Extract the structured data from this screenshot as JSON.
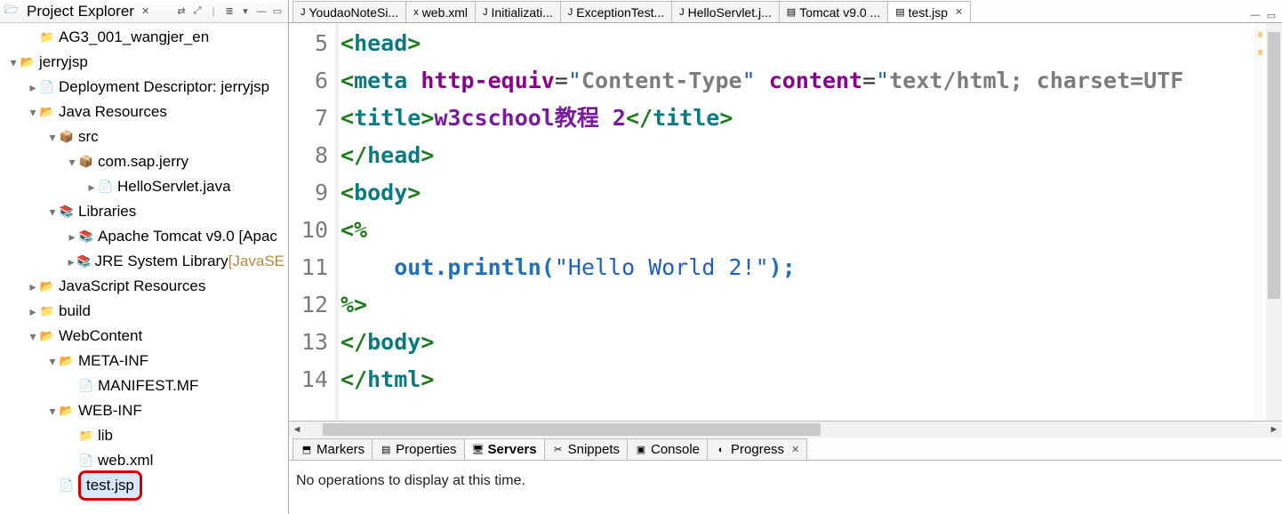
{
  "explorer": {
    "title": "Project Explorer",
    "toolbar": [
      "link-editor-icon",
      "collapse-all-icon",
      "view-menu-icon",
      "minimize-icon",
      "maximize-icon"
    ],
    "nodes": [
      {
        "indent": 1,
        "arrow": "",
        "icon": "📁",
        "label": "AG3_001_wangjer_en"
      },
      {
        "indent": 0,
        "arrow": "▾",
        "icon": "📂",
        "label": "jerryjsp"
      },
      {
        "indent": 1,
        "arrow": "▸",
        "icon": "📄",
        "label": "Deployment Descriptor: jerryjsp"
      },
      {
        "indent": 1,
        "arrow": "▾",
        "icon": "📂",
        "label": "Java Resources"
      },
      {
        "indent": 2,
        "arrow": "▾",
        "icon": "📦",
        "label": "src"
      },
      {
        "indent": 3,
        "arrow": "▾",
        "icon": "📦",
        "label": "com.sap.jerry"
      },
      {
        "indent": 4,
        "arrow": "▸",
        "icon": "📄",
        "label": "HelloServlet.java"
      },
      {
        "indent": 2,
        "arrow": "▾",
        "icon": "📚",
        "label": "Libraries"
      },
      {
        "indent": 3,
        "arrow": "▸",
        "icon": "📚",
        "label": "Apache Tomcat v9.0 [Apac",
        "gray": false
      },
      {
        "indent": 3,
        "arrow": "▸",
        "icon": "📚",
        "label": "JRE System Library ",
        "gray": true,
        "suffix": "[JavaSE"
      },
      {
        "indent": 1,
        "arrow": "▸",
        "icon": "📂",
        "label": "JavaScript Resources"
      },
      {
        "indent": 1,
        "arrow": "▸",
        "icon": "📁",
        "label": "build"
      },
      {
        "indent": 1,
        "arrow": "▾",
        "icon": "📂",
        "label": "WebContent"
      },
      {
        "indent": 2,
        "arrow": "▾",
        "icon": "📂",
        "label": "META-INF"
      },
      {
        "indent": 3,
        "arrow": "",
        "icon": "📄",
        "label": "MANIFEST.MF"
      },
      {
        "indent": 2,
        "arrow": "▾",
        "icon": "📂",
        "label": "WEB-INF"
      },
      {
        "indent": 3,
        "arrow": "",
        "icon": "📁",
        "label": "lib"
      },
      {
        "indent": 3,
        "arrow": "",
        "icon": "📄",
        "label": "web.xml"
      },
      {
        "indent": 2,
        "arrow": "",
        "icon": "📄",
        "label": "test.jsp",
        "selected": true
      }
    ]
  },
  "editorTabs": [
    {
      "label": "YoudaoNoteSi...",
      "icon": "J"
    },
    {
      "label": "web.xml",
      "icon": "x"
    },
    {
      "label": "Initializati...",
      "icon": "J"
    },
    {
      "label": "ExceptionTest...",
      "icon": "J"
    },
    {
      "label": "HelloServlet.j...",
      "icon": "J"
    },
    {
      "label": "Tomcat v9.0 ...",
      "icon": "▤"
    },
    {
      "label": "test.jsp",
      "icon": "▤",
      "active": true
    }
  ],
  "code": {
    "startLine": 5,
    "lines": [
      {
        "n": 5,
        "html": "<span class='k-delim'>&lt;</span><span class='k-tag'>head</span><span class='k-delim'>&gt;</span>"
      },
      {
        "n": 6,
        "html": "<span class='k-delim'>&lt;</span><span class='k-tag'>meta</span> <span class='k-attr'>http-equiv</span><span class='k-plain'>=</span><span class='k-str'>\"</span><span class='k-val'>Content-Type</span><span class='k-str'>\"</span> <span class='k-attr'>content</span><span class='k-plain'>=</span><span class='k-str'>\"</span><span class='k-val'>text/html; charset=UTF</span>"
      },
      {
        "n": 7,
        "html": "<span class='k-delim'>&lt;</span><span class='k-tag'>title</span><span class='k-delim'>&gt;</span><span class='k-txt'>w3cschool教程 2</span><span class='k-delim'>&lt;/</span><span class='k-tag'>title</span><span class='k-delim'>&gt;</span>"
      },
      {
        "n": 8,
        "html": "<span class='k-delim'>&lt;/</span><span class='k-tag'>head</span><span class='k-delim'>&gt;</span>"
      },
      {
        "n": 9,
        "html": "<span class='k-delim'>&lt;</span><span class='k-tag'>body</span><span class='k-delim'>&gt;</span>"
      },
      {
        "n": 10,
        "html": "<span class='k-delim'>&lt;%</span>"
      },
      {
        "n": 11,
        "html": "    <span class='k-call'>out.println(</span><span class='k-str'>\"Hello World 2!\"</span><span class='k-call'>);</span>"
      },
      {
        "n": 12,
        "html": "<span class='k-delim'>%&gt;</span>"
      },
      {
        "n": 13,
        "html": "<span class='k-delim'>&lt;/</span><span class='k-tag'>body</span><span class='k-delim'>&gt;</span>"
      },
      {
        "n": 14,
        "html": "<span class='k-delim'>&lt;/</span><span class='k-tag'>html</span><span class='k-delim'>&gt;</span>"
      }
    ]
  },
  "bottomTabs": [
    {
      "label": "Markers",
      "icon": "⬒"
    },
    {
      "label": "Properties",
      "icon": "▤"
    },
    {
      "label": "Servers",
      "icon": "🖥",
      "active": true,
      "bold": true
    },
    {
      "label": "Snippets",
      "icon": "✂"
    },
    {
      "label": "Console",
      "icon": "▣"
    },
    {
      "label": "Progress",
      "icon": "◐",
      "close": true
    }
  ],
  "bottomBody": "No operations to display at this time."
}
